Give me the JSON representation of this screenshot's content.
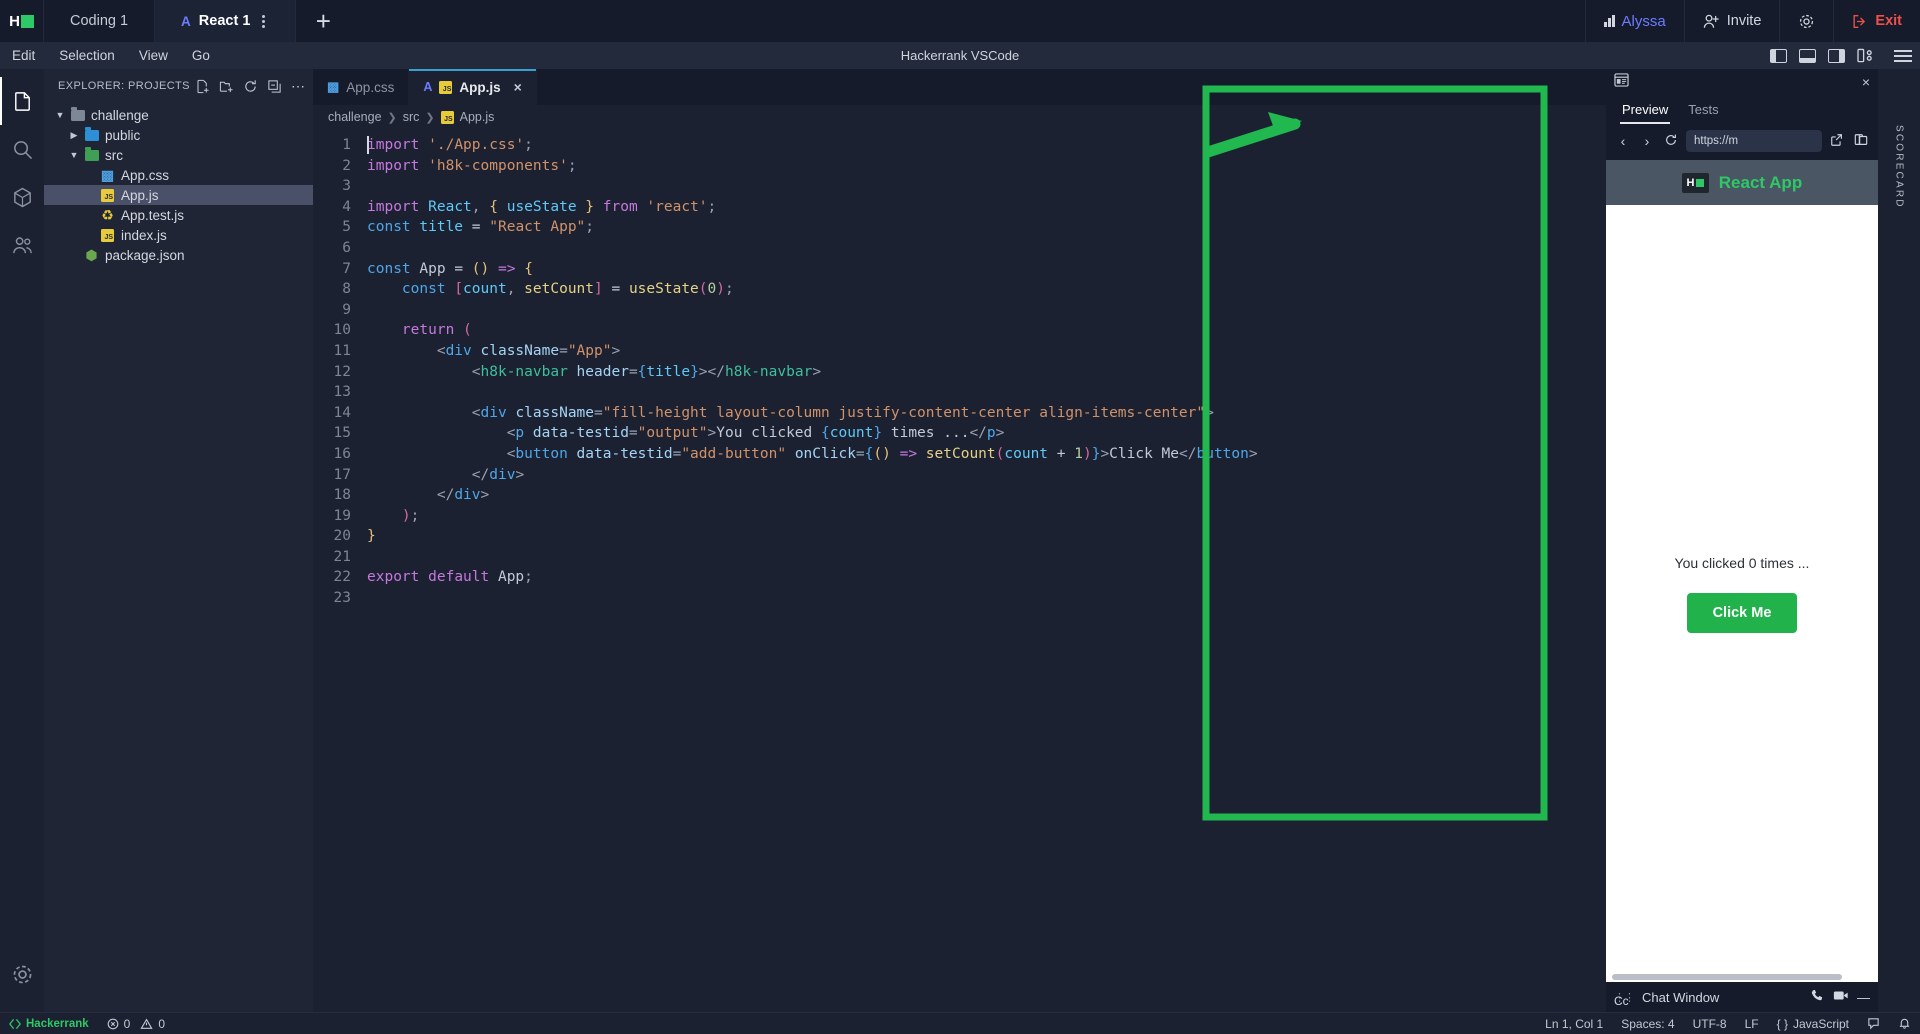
{
  "topbar": {
    "logo": "hackerrank-logo",
    "tabs": [
      {
        "label": "Coding 1",
        "active": false,
        "badge": ""
      },
      {
        "label": "React 1",
        "active": true,
        "badge": "A"
      }
    ],
    "add_tab": "+",
    "user": "Alyssa",
    "invite_label": "Invite",
    "settings_icon": "gear-icon",
    "exit_label": "Exit"
  },
  "menubar": {
    "items": [
      "Edit",
      "Selection",
      "View",
      "Go"
    ],
    "title": "Hackerrank VSCode"
  },
  "activitybar": {
    "items": [
      {
        "name": "explorer",
        "icon": "files-icon",
        "active": true
      },
      {
        "name": "search",
        "icon": "search-icon",
        "active": false
      },
      {
        "name": "extensions",
        "icon": "extensions-icon",
        "active": false
      },
      {
        "name": "accounts",
        "icon": "people-icon",
        "active": false
      }
    ],
    "bottom": {
      "name": "manage",
      "icon": "gear-icon"
    }
  },
  "sidebar": {
    "title": "EXPLORER: PROJECTS",
    "actions": [
      "new-file-icon",
      "new-folder-icon",
      "refresh-icon",
      "collapse-icon",
      "more-icon"
    ],
    "tree": [
      {
        "label": "challenge",
        "type": "folder",
        "depth": 0,
        "expanded": true,
        "selected": false
      },
      {
        "label": "public",
        "type": "folder-blue",
        "depth": 1,
        "expanded": false,
        "selected": false
      },
      {
        "label": "src",
        "type": "folder-green",
        "depth": 1,
        "expanded": true,
        "selected": false
      },
      {
        "label": "App.css",
        "type": "css",
        "depth": 2,
        "selected": false
      },
      {
        "label": "App.js",
        "type": "js",
        "depth": 2,
        "selected": true
      },
      {
        "label": "App.test.js",
        "type": "test",
        "depth": 2,
        "selected": false
      },
      {
        "label": "index.js",
        "type": "js",
        "depth": 2,
        "selected": false
      },
      {
        "label": "package.json",
        "type": "pkg",
        "depth": 1,
        "selected": false
      }
    ]
  },
  "editor": {
    "tabs": [
      {
        "label": "App.css",
        "icon": "css-icon",
        "active": false,
        "badge": ""
      },
      {
        "label": "App.js",
        "icon": "js-icon",
        "active": true,
        "badge": "A",
        "close": "×"
      }
    ],
    "breadcrumb": [
      "challenge",
      "src",
      "App.js"
    ],
    "lines": [
      {
        "n": "1",
        "tokens": [
          [
            "t-kw",
            "import"
          ],
          [
            "t-plain",
            " "
          ],
          [
            "t-str",
            "'./App.css'"
          ],
          [
            "t-punc",
            ";"
          ]
        ]
      },
      {
        "n": "2",
        "tokens": [
          [
            "t-kw",
            "import"
          ],
          [
            "t-plain",
            " "
          ],
          [
            "t-str",
            "'h8k-components'"
          ],
          [
            "t-punc",
            ";"
          ]
        ]
      },
      {
        "n": "3",
        "tokens": []
      },
      {
        "n": "4",
        "tokens": [
          [
            "t-kw",
            "import"
          ],
          [
            "t-plain",
            " "
          ],
          [
            "t-var",
            "React"
          ],
          [
            "t-punc",
            ", "
          ],
          [
            "t-brkt1",
            "{"
          ],
          [
            "t-plain",
            " "
          ],
          [
            "t-var",
            "useState"
          ],
          [
            "t-plain",
            " "
          ],
          [
            "t-brkt1",
            "}"
          ],
          [
            "t-plain",
            " "
          ],
          [
            "t-kw",
            "from"
          ],
          [
            "t-plain",
            " "
          ],
          [
            "t-str",
            "'react'"
          ],
          [
            "t-punc",
            ";"
          ]
        ]
      },
      {
        "n": "5",
        "tokens": [
          [
            "t-kw2",
            "const"
          ],
          [
            "t-plain",
            " "
          ],
          [
            "t-var",
            "title"
          ],
          [
            "t-plain",
            " = "
          ],
          [
            "t-str",
            "\"React App\""
          ],
          [
            "t-punc",
            ";"
          ]
        ]
      },
      {
        "n": "6",
        "tokens": []
      },
      {
        "n": "7",
        "tokens": [
          [
            "t-kw2",
            "const"
          ],
          [
            "t-plain",
            " "
          ],
          [
            "t-plain",
            "App"
          ],
          [
            "t-plain",
            " = "
          ],
          [
            "t-brkt1",
            "()"
          ],
          [
            "t-plain",
            " "
          ],
          [
            "t-kw",
            "=>"
          ],
          [
            "t-plain",
            " "
          ],
          [
            "t-brkt1",
            "{"
          ]
        ]
      },
      {
        "n": "8",
        "tokens": [
          [
            "t-plain",
            "    "
          ],
          [
            "t-kw2",
            "const"
          ],
          [
            "t-plain",
            " "
          ],
          [
            "t-brkt2",
            "["
          ],
          [
            "t-var",
            "count"
          ],
          [
            "t-punc",
            ", "
          ],
          [
            "t-fn",
            "setCount"
          ],
          [
            "t-brkt2",
            "]"
          ],
          [
            "t-plain",
            " = "
          ],
          [
            "t-fn",
            "useState"
          ],
          [
            "t-brkt2",
            "("
          ],
          [
            "t-num",
            "0"
          ],
          [
            "t-brkt2",
            ")"
          ],
          [
            "t-punc",
            ";"
          ]
        ]
      },
      {
        "n": "9",
        "tokens": []
      },
      {
        "n": "10",
        "tokens": [
          [
            "t-plain",
            "    "
          ],
          [
            "t-kw",
            "return"
          ],
          [
            "t-plain",
            " "
          ],
          [
            "t-brkt2",
            "("
          ]
        ]
      },
      {
        "n": "11",
        "tokens": [
          [
            "t-plain",
            "        "
          ],
          [
            "t-punc",
            "<"
          ],
          [
            "t-tag",
            "div"
          ],
          [
            "t-plain",
            " "
          ],
          [
            "t-attr",
            "className"
          ],
          [
            "t-punc",
            "="
          ],
          [
            "t-str",
            "\"App\""
          ],
          [
            "t-punc",
            ">"
          ]
        ]
      },
      {
        "n": "12",
        "tokens": [
          [
            "t-plain",
            "            "
          ],
          [
            "t-punc",
            "<"
          ],
          [
            "t-tag2",
            "h8k-navbar"
          ],
          [
            "t-plain",
            " "
          ],
          [
            "t-attr",
            "header"
          ],
          [
            "t-punc",
            "="
          ],
          [
            "t-brkt3",
            "{"
          ],
          [
            "t-var",
            "title"
          ],
          [
            "t-brkt3",
            "}"
          ],
          [
            "t-punc",
            ">"
          ],
          [
            "t-punc",
            "</"
          ],
          [
            "t-tag2",
            "h8k-navbar"
          ],
          [
            "t-punc",
            ">"
          ]
        ]
      },
      {
        "n": "13",
        "tokens": []
      },
      {
        "n": "14",
        "tokens": [
          [
            "t-plain",
            "            "
          ],
          [
            "t-punc",
            "<"
          ],
          [
            "t-tag",
            "div"
          ],
          [
            "t-plain",
            " "
          ],
          [
            "t-attr",
            "className"
          ],
          [
            "t-punc",
            "="
          ],
          [
            "t-str",
            "\"fill-height layout-column justify-content-center align-items-center\""
          ],
          [
            "t-punc",
            ">"
          ]
        ]
      },
      {
        "n": "15",
        "tokens": [
          [
            "t-plain",
            "                "
          ],
          [
            "t-punc",
            "<"
          ],
          [
            "t-tag",
            "p"
          ],
          [
            "t-plain",
            " "
          ],
          [
            "t-attr",
            "data-testid"
          ],
          [
            "t-punc",
            "="
          ],
          [
            "t-str",
            "\"output\""
          ],
          [
            "t-punc",
            ">"
          ],
          [
            "t-plain",
            "You clicked "
          ],
          [
            "t-brkt3",
            "{"
          ],
          [
            "t-var",
            "count"
          ],
          [
            "t-brkt3",
            "}"
          ],
          [
            "t-plain",
            " times ..."
          ],
          [
            "t-punc",
            "</"
          ],
          [
            "t-tag",
            "p"
          ],
          [
            "t-punc",
            ">"
          ]
        ]
      },
      {
        "n": "16",
        "tokens": [
          [
            "t-plain",
            "                "
          ],
          [
            "t-punc",
            "<"
          ],
          [
            "t-tag",
            "button"
          ],
          [
            "t-plain",
            " "
          ],
          [
            "t-attr",
            "data-testid"
          ],
          [
            "t-punc",
            "="
          ],
          [
            "t-str",
            "\"add-button\""
          ],
          [
            "t-plain",
            " "
          ],
          [
            "t-attr",
            "onClick"
          ],
          [
            "t-punc",
            "="
          ],
          [
            "t-brkt3",
            "{"
          ],
          [
            "t-brkt1",
            "()"
          ],
          [
            "t-plain",
            " "
          ],
          [
            "t-kw",
            "=>"
          ],
          [
            "t-plain",
            " "
          ],
          [
            "t-fn",
            "setCount"
          ],
          [
            "t-brkt2",
            "("
          ],
          [
            "t-var",
            "count"
          ],
          [
            "t-plain",
            " + "
          ],
          [
            "t-num",
            "1"
          ],
          [
            "t-brkt2",
            ")"
          ],
          [
            "t-brkt3",
            "}"
          ],
          [
            "t-punc",
            ">"
          ],
          [
            "t-plain",
            "Click Me"
          ],
          [
            "t-punc",
            "</"
          ],
          [
            "t-tag",
            "button"
          ],
          [
            "t-punc",
            ">"
          ]
        ]
      },
      {
        "n": "17",
        "tokens": [
          [
            "t-plain",
            "            "
          ],
          [
            "t-punc",
            "</"
          ],
          [
            "t-tag",
            "div"
          ],
          [
            "t-punc",
            ">"
          ]
        ]
      },
      {
        "n": "18",
        "tokens": [
          [
            "t-plain",
            "        "
          ],
          [
            "t-punc",
            "</"
          ],
          [
            "t-tag",
            "div"
          ],
          [
            "t-punc",
            ">"
          ]
        ]
      },
      {
        "n": "19",
        "tokens": [
          [
            "t-plain",
            "    "
          ],
          [
            "t-brkt2",
            ")"
          ],
          [
            "t-punc",
            ";"
          ]
        ]
      },
      {
        "n": "20",
        "tokens": [
          [
            "t-brkt1",
            "}"
          ]
        ]
      },
      {
        "n": "21",
        "tokens": []
      },
      {
        "n": "22",
        "tokens": [
          [
            "t-kw",
            "export"
          ],
          [
            "t-plain",
            " "
          ],
          [
            "t-kw",
            "default"
          ],
          [
            "t-plain",
            " "
          ],
          [
            "t-plain",
            "App"
          ],
          [
            "t-punc",
            ";"
          ]
        ]
      },
      {
        "n": "23",
        "tokens": []
      }
    ]
  },
  "preview": {
    "tabs": [
      {
        "label": "Preview",
        "active": true
      },
      {
        "label": "Tests",
        "active": false
      }
    ],
    "url": "https://m",
    "nav": {
      "back": "‹",
      "forward": "›",
      "reload": "reload-icon",
      "open_external": "open-external-icon",
      "split": "split-icon"
    },
    "close": "×",
    "app": {
      "navbar_title": "React App",
      "output_text": "You clicked 0 times ...",
      "button_label": "Click Me"
    },
    "footer": {
      "chat_label": "Chat Window",
      "cc_label": "Cc",
      "phone_icon": "phone-icon",
      "video_icon": "video-icon",
      "minimize_icon": "minimize-icon"
    }
  },
  "rightrail": {
    "label": "SCORECARD"
  },
  "statusbar": {
    "brand": "Hackerrank",
    "errors": "0",
    "warnings": "0",
    "position": "Ln 1, Col 1",
    "spaces": "Spaces: 4",
    "encoding": "UTF-8",
    "eol": "LF",
    "language": "JavaScript",
    "bell_icon": "bell-icon",
    "feedback_icon": "feedback-icon"
  },
  "colors": {
    "accent_green": "#2ec866",
    "annotation_green": "#21b84f",
    "exit_red": "#f0504a",
    "user_blue": "#6e7bff",
    "editor_bg": "#1b2130",
    "sidebar_bg": "#1f2535",
    "topbar_bg": "#151b2b"
  }
}
